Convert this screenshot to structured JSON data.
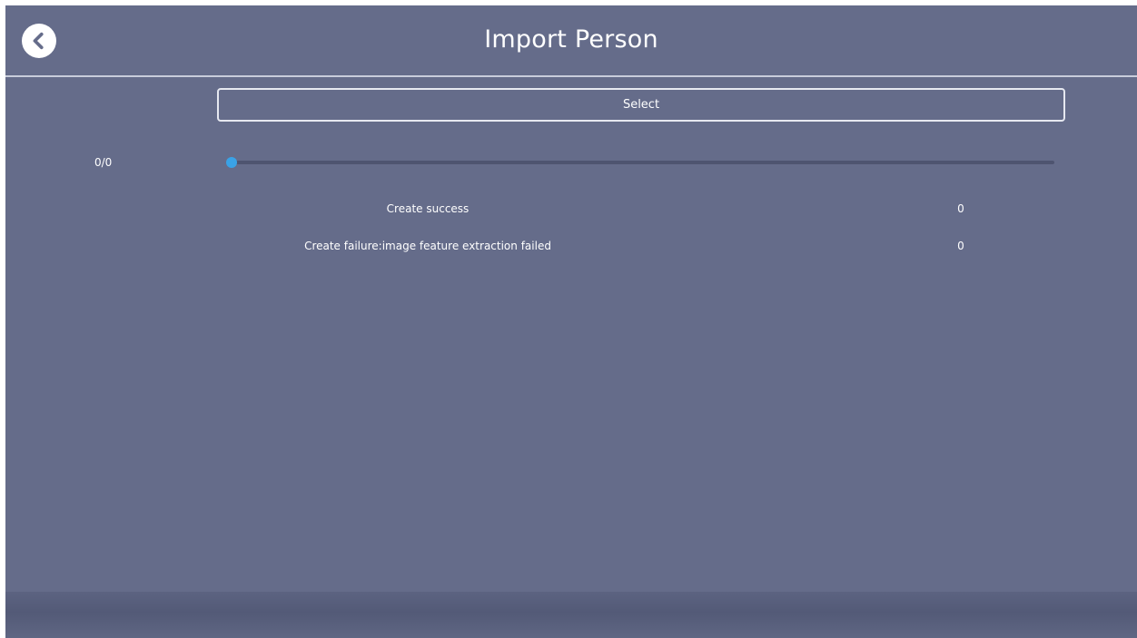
{
  "header": {
    "title": "Import Person",
    "back_icon": "chevron-left-icon"
  },
  "import": {
    "select_label": "Select",
    "progress_text": "0/0",
    "progress_value": 0,
    "progress_max": 0
  },
  "results": [
    {
      "label": "Create success",
      "value": "0"
    },
    {
      "label": "Create failure:image feature extraction failed",
      "value": "0"
    }
  ],
  "colors": {
    "background": "#656c8a",
    "accent": "#3aa2e6",
    "header_line": "#c9cddb",
    "text": "#ffffff"
  }
}
